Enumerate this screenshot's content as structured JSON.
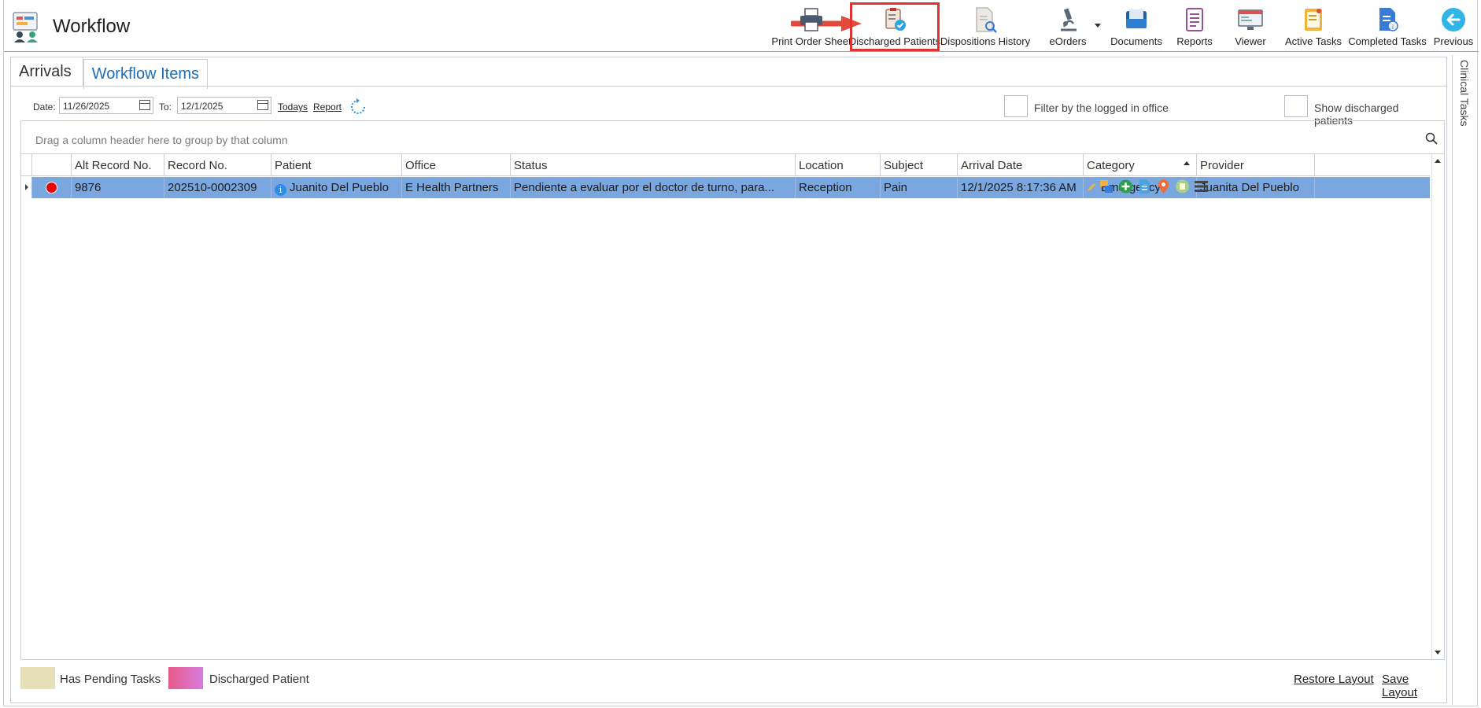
{
  "app": {
    "title": "Workflow"
  },
  "toolbar": {
    "print_order_sheet": "Print Order Sheet",
    "discharged_patients": "Discharged Patients",
    "dispositions_history": "Dispositions History",
    "eorders": "eOrders",
    "documents": "Documents",
    "reports": "Reports",
    "viewer": "Viewer",
    "active_tasks": "Active Tasks",
    "completed_tasks": "Completed Tasks",
    "previous": "Previous"
  },
  "side_panel": {
    "label": "Clinical Tasks"
  },
  "tabs": [
    {
      "label": "Arrivals"
    },
    {
      "label": "Workflow Items"
    }
  ],
  "filter": {
    "date_label": "Date:",
    "date_from": "11/26/2025",
    "to_label": "To:",
    "date_to": "12/1/2025",
    "todays_link": "Todays",
    "report_link": "Report",
    "filter_office_label": "Filter by the logged in office",
    "show_discharged_label": "Show discharged patients"
  },
  "grid": {
    "group_hint": "Drag a column header here to group by that column",
    "columns": [
      "Alt Record No.",
      "Record No.",
      "Patient",
      "Office",
      "Status",
      "Location",
      "Subject",
      "Arrival Date",
      "Category",
      "Provider"
    ],
    "rows": [
      {
        "alt_record_no": "9876",
        "record_no": "202510-0002309",
        "patient": "Juanito Del Pueblo",
        "office": "E Health Partners",
        "status": "Pendiente a evaluar por el doctor de turno, para...",
        "location": "Reception",
        "subject": "Pain",
        "arrival_date": "12/1/2025 8:17:36 AM",
        "category": "Emergency",
        "provider": "Juanita Del Pueblo"
      }
    ]
  },
  "legend": {
    "pending_label": "Has Pending Tasks",
    "discharged_label": "Discharged Patient",
    "restore_layout": "Restore Layout",
    "save_layout": "Save Layout"
  },
  "colors": {
    "selected_row": "#7aa7e0",
    "pending_swatch": "#e6dfb8",
    "discharged_swatch_from": "#e85b8a",
    "discharged_swatch_to": "#d77be0",
    "highlight_outline": "#e0322f",
    "tab_active_text": "#1f6db5"
  }
}
